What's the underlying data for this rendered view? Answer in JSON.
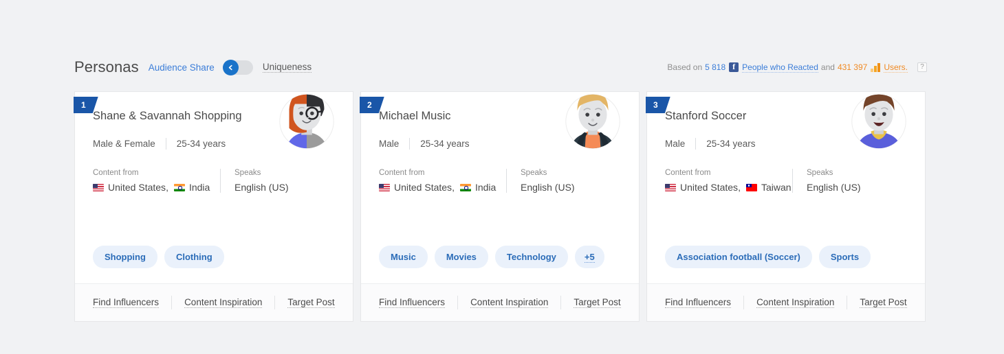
{
  "header": {
    "title": "Personas",
    "toggle_label_left": "Audience Share",
    "toggle_label_right": "Uniqueness",
    "toggle_state": "left",
    "based_on_prefix": "Based on",
    "reacted_count": "5 818",
    "reacted_label": "People who Reacted",
    "conjunction": "and",
    "users_count": "431 397",
    "users_label": "Users.",
    "help_label": "?",
    "accent_blue": "#3b7dd8",
    "accent_orange": "#f08a24",
    "facebook_blue": "#3b5998"
  },
  "cards": [
    {
      "rank": "1",
      "name": "Shane & Savannah Shopping",
      "gender": "Male & Female",
      "age": "25-34 years",
      "content_from_label": "Content from",
      "countries": [
        {
          "name": "United States",
          "flag": "us-flag-icon"
        },
        {
          "name": "India",
          "flag": "india-flag-icon"
        }
      ],
      "speaks_label": "Speaks",
      "language": "English (US)",
      "tags": [
        "Shopping",
        "Clothing"
      ],
      "more_tags": null,
      "avatar": "avatar-split-female-male",
      "footer_links": [
        "Find Influencers",
        "Content Inspiration",
        "Target Post"
      ]
    },
    {
      "rank": "2",
      "name": "Michael Music",
      "gender": "Male",
      "age": "25-34 years",
      "content_from_label": "Content from",
      "countries": [
        {
          "name": "United States",
          "flag": "us-flag-icon"
        },
        {
          "name": "India",
          "flag": "india-flag-icon"
        }
      ],
      "speaks_label": "Speaks",
      "language": "English (US)",
      "tags": [
        "Music",
        "Movies",
        "Technology"
      ],
      "more_tags": "+5",
      "avatar": "avatar-blond-male",
      "footer_links": [
        "Find Influencers",
        "Content Inspiration",
        "Target Post"
      ]
    },
    {
      "rank": "3",
      "name": "Stanford Soccer",
      "gender": "Male",
      "age": "25-34 years",
      "content_from_label": "Content from",
      "countries": [
        {
          "name": "United States",
          "flag": "us-flag-icon"
        },
        {
          "name": "Taiwan",
          "flag": "taiwan-flag-icon"
        }
      ],
      "speaks_label": "Speaks",
      "language": "English (US)",
      "tags": [
        "Association football (Soccer)",
        "Sports"
      ],
      "more_tags": null,
      "avatar": "avatar-brown-hair-male",
      "footer_links": [
        "Find Influencers",
        "Content Inspiration",
        "Target Post"
      ]
    }
  ]
}
